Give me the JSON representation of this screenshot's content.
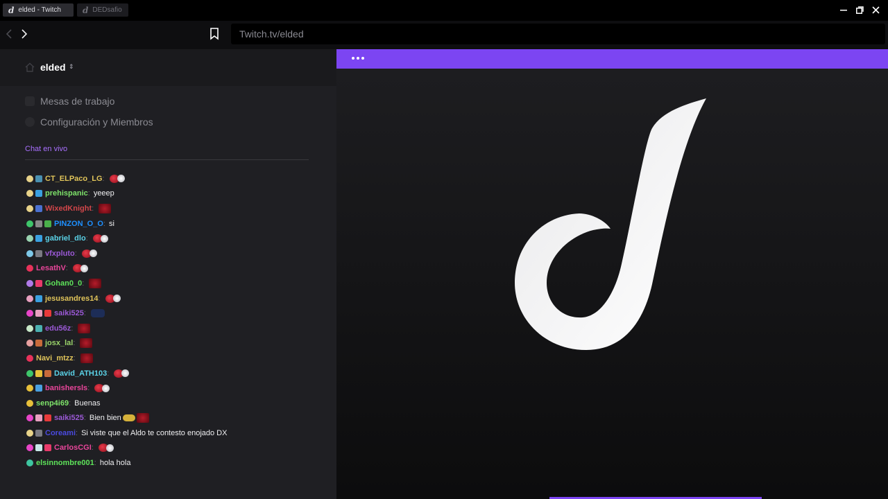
{
  "window": {
    "tabs": [
      {
        "label": "elded - Twitch",
        "active": true
      },
      {
        "label": "DEDsafio",
        "active": false
      }
    ],
    "controls": [
      "minimize-icon",
      "restore-icon",
      "close-icon"
    ]
  },
  "navbar": {
    "url": "Twitch.tv/elded"
  },
  "sidebar": {
    "workspace_name": "elded",
    "menu": [
      {
        "label": "Mesas de trabajo"
      },
      {
        "label": "Configuración y Miembros"
      }
    ],
    "chat_label": "Chat en vivo"
  },
  "chat": [
    {
      "user": "CT_ELPaco_LG",
      "color": "#e0c45a",
      "text": ""
    },
    {
      "user": "prehispanic",
      "color": "#7ee36a",
      "text": "yeeep"
    },
    {
      "user": "WixedKnight",
      "color": "#d2464a",
      "text": ""
    },
    {
      "user": "PINZON_O_O",
      "color": "#1e90ff",
      "text": "si"
    },
    {
      "user": "gabriel_dlo",
      "color": "#5bd3e8",
      "text": ""
    },
    {
      "user": "vfxpluto",
      "color": "#9b59d6",
      "text": ""
    },
    {
      "user": "LesathV",
      "color": "#e8459a",
      "text": ""
    },
    {
      "user": "Gohan0_0",
      "color": "#5ee35a",
      "text": ""
    },
    {
      "user": "jesusandres14",
      "color": "#e0c45a",
      "text": ""
    },
    {
      "user": "saiki525",
      "color": "#9b59d6",
      "text": ""
    },
    {
      "user": "edu56z",
      "color": "#9b59d6",
      "text": ""
    },
    {
      "user": "josx_lal",
      "color": "#9ad36a",
      "text": ""
    },
    {
      "user": "Navi_mtzz",
      "color": "#e0c45a",
      "text": ""
    },
    {
      "user": "David_ATH103",
      "color": "#5bd3e8",
      "text": ""
    },
    {
      "user": "banishersls",
      "color": "#e8459a",
      "text": ""
    },
    {
      "user": "senp4i69",
      "color": "#7ee36a",
      "text": "Buenas"
    },
    {
      "user": "saiki525",
      "color": "#9b59d6",
      "text": "Bien bien"
    },
    {
      "user": "Coreami",
      "color": "#4a4ae0",
      "text": "Si viste que el Aldo te contesto enojado DX"
    },
    {
      "user": "CarlosCGI",
      "color": "#e8459a",
      "text": ""
    },
    {
      "user": "elsinnombre001",
      "color": "#5ee35a",
      "text": "hola hola"
    }
  ],
  "player": {
    "menu_icon": "more-dots-icon"
  }
}
